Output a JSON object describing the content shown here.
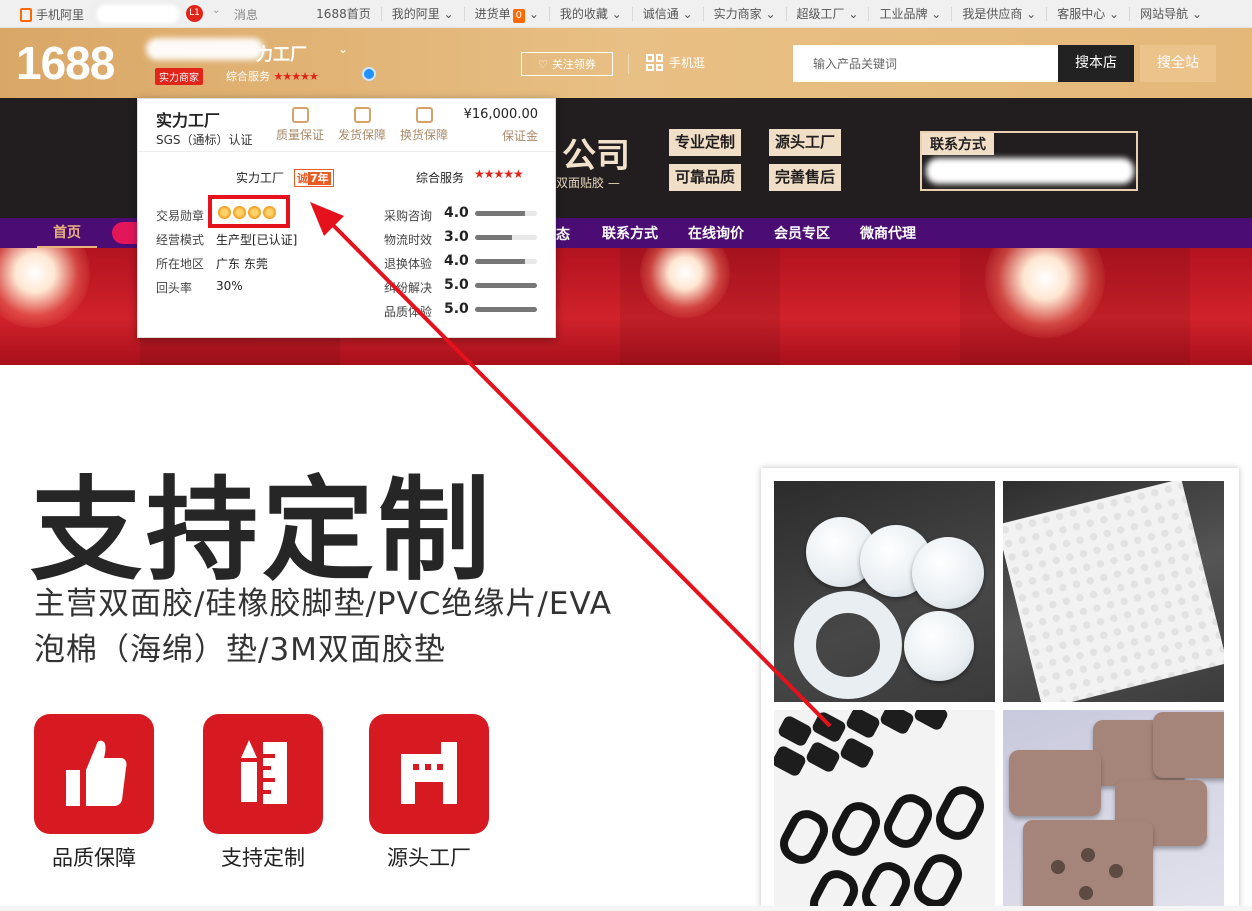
{
  "topbar": {
    "mobile_label": "手机阿里",
    "level": "L1",
    "messages": "消息",
    "nav": [
      "1688首页",
      "我的阿里",
      "进货单",
      "我的收藏",
      "诚信通",
      "实力商家",
      "超级工厂",
      "工业品牌",
      "我是供应商",
      "客服中心",
      "网站导航"
    ],
    "cart_count": "0"
  },
  "header": {
    "logo": "1688",
    "shop_suffix": "力工厂",
    "badge": "实力商家",
    "service_label": "综合服务",
    "service_stars": "★★★★★",
    "follow_label": "关注领券",
    "mobile_shop": "手机逛",
    "search_placeholder": "输入产品关键词",
    "search_store": "搜本店",
    "search_all": "搜全站"
  },
  "banner": {
    "company_suffix": "公司",
    "subtitle": "双面贴胶 —",
    "tags": [
      "专业定制",
      "源头工厂",
      "可靠品质",
      "完善售后"
    ],
    "contact_title": "联系方式"
  },
  "navbar": {
    "home": "首页",
    "partial": "态",
    "links": [
      "联系方式",
      "在线询价",
      "会员专区",
      "微商代理"
    ]
  },
  "popup": {
    "title": "实力工厂",
    "cert": "SGS（通标）认证",
    "guarantees": [
      "质量保证",
      "发货保障",
      "换货保障"
    ],
    "deposit": "¥16,000.00",
    "deposit_label": "保证金",
    "factory_label": "实力工厂",
    "years_prefix": "诚",
    "years": "7年",
    "service_label": "综合服务",
    "service_stars": "★★★★★",
    "info": [
      {
        "label": "交易勋章",
        "value": ""
      },
      {
        "label": "经营模式",
        "value": "生产型[已认证]"
      },
      {
        "label": "所在地区",
        "value": "广东 东莞"
      },
      {
        "label": "回头率",
        "value": "30%"
      }
    ],
    "medal_count": 4,
    "scores": [
      {
        "label": "采购咨询",
        "value": "4.0",
        "ratio": 0.8
      },
      {
        "label": "物流时效",
        "value": "3.0",
        "ratio": 0.6
      },
      {
        "label": "退换体验",
        "value": "4.0",
        "ratio": 0.8
      },
      {
        "label": "纠纷解决",
        "value": "5.0",
        "ratio": 1.0
      },
      {
        "label": "品质体验",
        "value": "5.0",
        "ratio": 1.0
      }
    ]
  },
  "main": {
    "headline": "支持定制",
    "desc_line1": "主营双面胶/硅橡胶脚垫/PVC绝缘片/EVA",
    "desc_line2": "泡棉（海绵）垫/3M双面胶垫",
    "features": [
      "品质保障",
      "支持定制",
      "源头工厂"
    ]
  },
  "colors": {
    "accent_red": "#d71921",
    "header_gold": "#e3b77a",
    "nav_purple": "#4b0d73",
    "annotation_red": "#e5121d"
  }
}
